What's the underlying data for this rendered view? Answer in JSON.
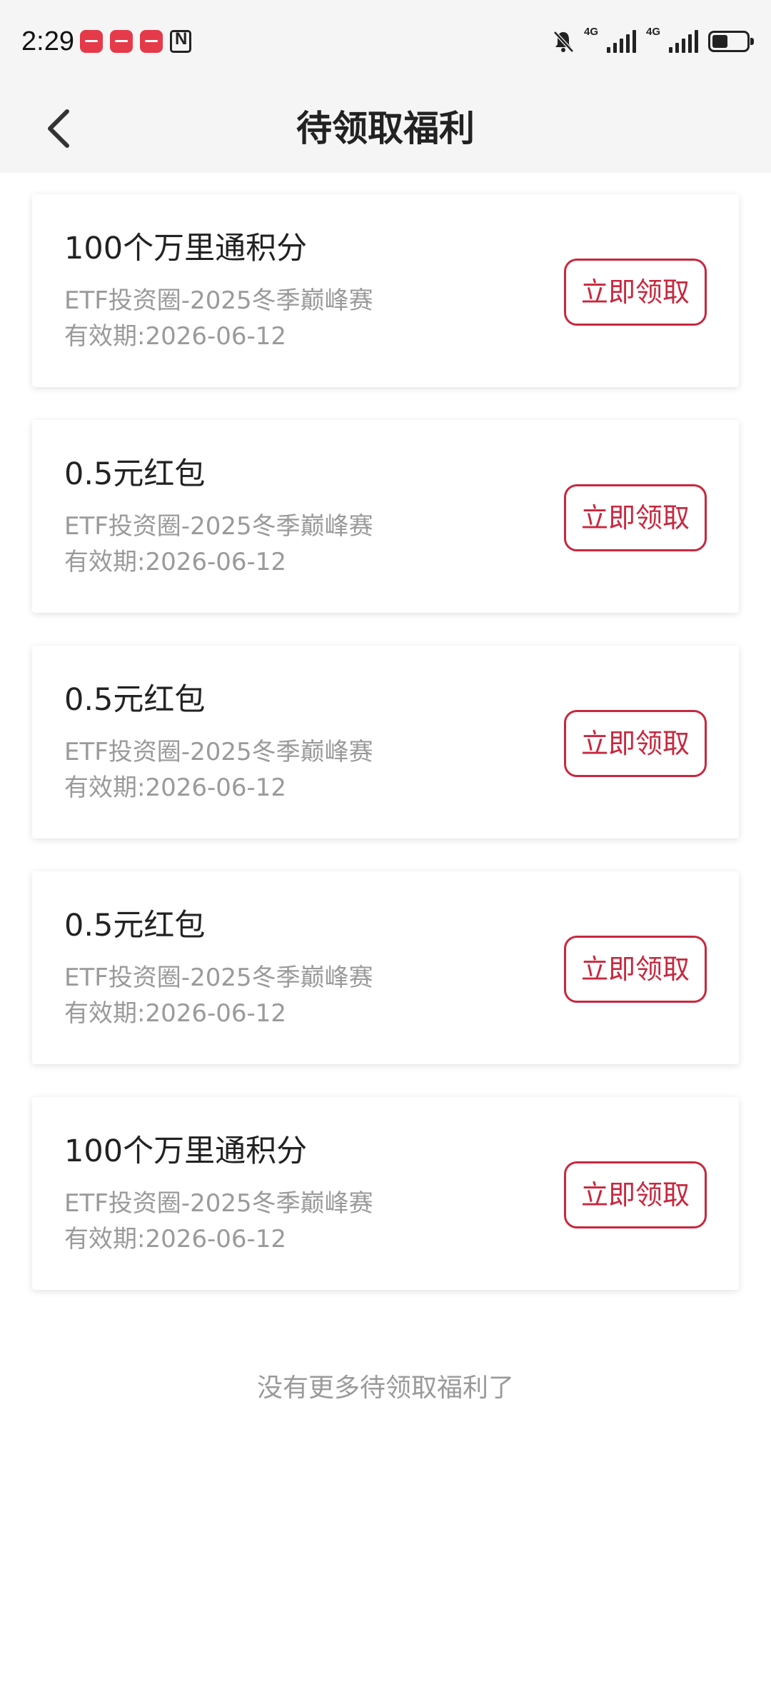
{
  "status_bar": {
    "time": "2:29",
    "network_1": "4G",
    "network_2": "4G",
    "battery_level": 0.45
  },
  "header": {
    "title": "待领取福利"
  },
  "rewards": [
    {
      "title": "100个万里通积分",
      "source": "ETF投资圈-2025冬季巅峰赛",
      "expiry": "有效期:2026-06-12",
      "button_label": "立即领取"
    },
    {
      "title": "0.5元红包",
      "source": "ETF投资圈-2025冬季巅峰赛",
      "expiry": "有效期:2026-06-12",
      "button_label": "立即领取"
    },
    {
      "title": "0.5元红包",
      "source": "ETF投资圈-2025冬季巅峰赛",
      "expiry": "有效期:2026-06-12",
      "button_label": "立即领取"
    },
    {
      "title": "0.5元红包",
      "source": "ETF投资圈-2025冬季巅峰赛",
      "expiry": "有效期:2026-06-12",
      "button_label": "立即领取"
    },
    {
      "title": "100个万里通积分",
      "source": "ETF投资圈-2025冬季巅峰赛",
      "expiry": "有效期:2026-06-12",
      "button_label": "立即领取"
    }
  ],
  "footer": {
    "note": "没有更多待领取福利了"
  },
  "colors": {
    "accent": "#c8283e",
    "header_bg": "#f5f5f5",
    "secondary_text": "#9a9a9a"
  }
}
